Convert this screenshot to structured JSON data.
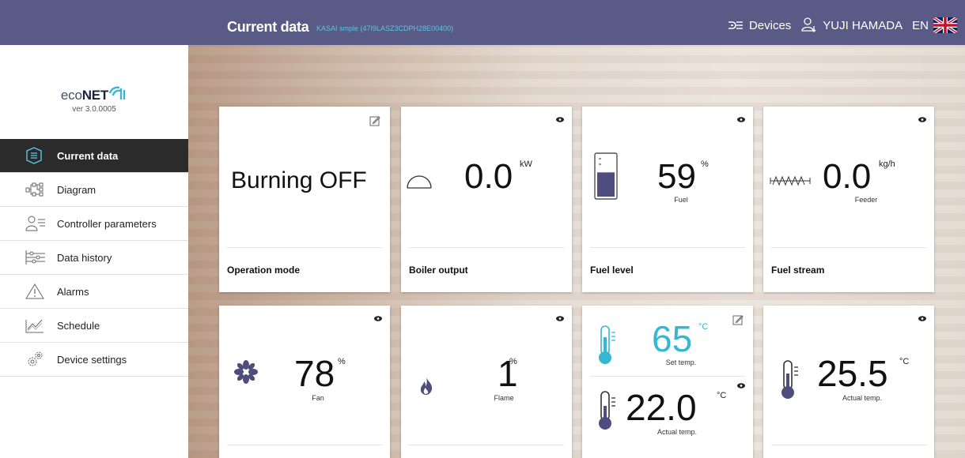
{
  "header": {
    "title": "Current data",
    "subtitle": "KASAI smple (47I9LASZ3CDPH28E00400)",
    "devices_label": "Devices",
    "user_name": "YUJI HAMADA",
    "language": "EN"
  },
  "sidebar": {
    "logo_text_light": "eco",
    "logo_text_bold": "NET",
    "version": "ver 3.0.0005",
    "items": [
      {
        "label": "Current data",
        "icon": "list-box-icon"
      },
      {
        "label": "Diagram",
        "icon": "diagram-icon"
      },
      {
        "label": "Controller parameters",
        "icon": "user-params-icon"
      },
      {
        "label": "Data history",
        "icon": "history-sliders-icon"
      },
      {
        "label": "Alarms",
        "icon": "warning-icon"
      },
      {
        "label": "Schedule",
        "icon": "chart-line-icon"
      },
      {
        "label": "Device settings",
        "icon": "gears-icon"
      }
    ]
  },
  "cards": {
    "operation_mode": {
      "value": "Burning OFF",
      "footer": "Operation mode"
    },
    "boiler_output": {
      "value": "0.0",
      "unit": "kW",
      "footer": "Boiler output"
    },
    "fuel_level": {
      "value": "59",
      "unit": "%",
      "caption": "Fuel",
      "footer": "Fuel level",
      "level_fraction": 0.59
    },
    "fuel_stream": {
      "value": "0.0",
      "unit": "kg/h",
      "caption": "Feeder",
      "footer": "Fuel stream"
    },
    "fan": {
      "value": "78",
      "unit": "%",
      "caption": "Fan"
    },
    "flame": {
      "value": "1",
      "unit": "%",
      "caption": "Flame"
    },
    "boiler_temp": {
      "set_value": "65",
      "set_unit": "°C",
      "set_caption": "Set temp.",
      "actual_value": "22.0",
      "actual_unit": "°C",
      "actual_caption": "Actual temp."
    },
    "room_temp": {
      "value": "25.5",
      "unit": "°C",
      "caption": "Actual temp."
    }
  },
  "colors": {
    "header_bg": "#5a5a86",
    "accent_teal": "#35b6d2",
    "subtitle": "#58c7e3",
    "active_nav": "#2b2b2b"
  }
}
